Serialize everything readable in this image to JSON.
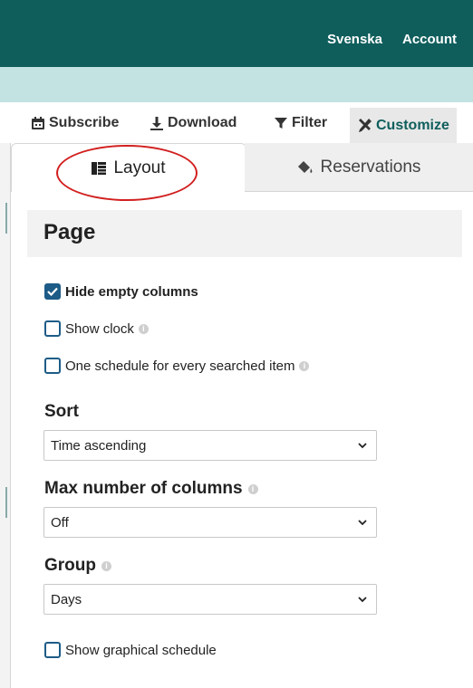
{
  "topbar": {
    "language_label": "Svenska",
    "account_label": "Account"
  },
  "toolbar": {
    "subscribe_label": "Subscribe",
    "download_label": "Download",
    "filter_label": "Filter",
    "customize_label": "Customize"
  },
  "tabs": {
    "layout_label": "Layout",
    "reservations_label": "Reservations"
  },
  "page_section": {
    "title": "Page",
    "hide_empty_columns": {
      "label": "Hide empty columns",
      "checked": true
    },
    "show_clock": {
      "label": "Show clock",
      "checked": false
    },
    "one_schedule": {
      "label": "One schedule for every searched item",
      "checked": false
    }
  },
  "sort": {
    "label": "Sort",
    "value": "Time ascending"
  },
  "max_columns": {
    "label": "Max number of columns",
    "value": "Off"
  },
  "group": {
    "label": "Group",
    "value": "Days"
  },
  "graphical": {
    "label": "Show graphical schedule",
    "checked": false
  },
  "colors": {
    "header_bg": "#0f5e5c",
    "band_bg": "#c3e2e2",
    "checkbox": "#1d5c87",
    "annotation": "#d21f1f"
  }
}
